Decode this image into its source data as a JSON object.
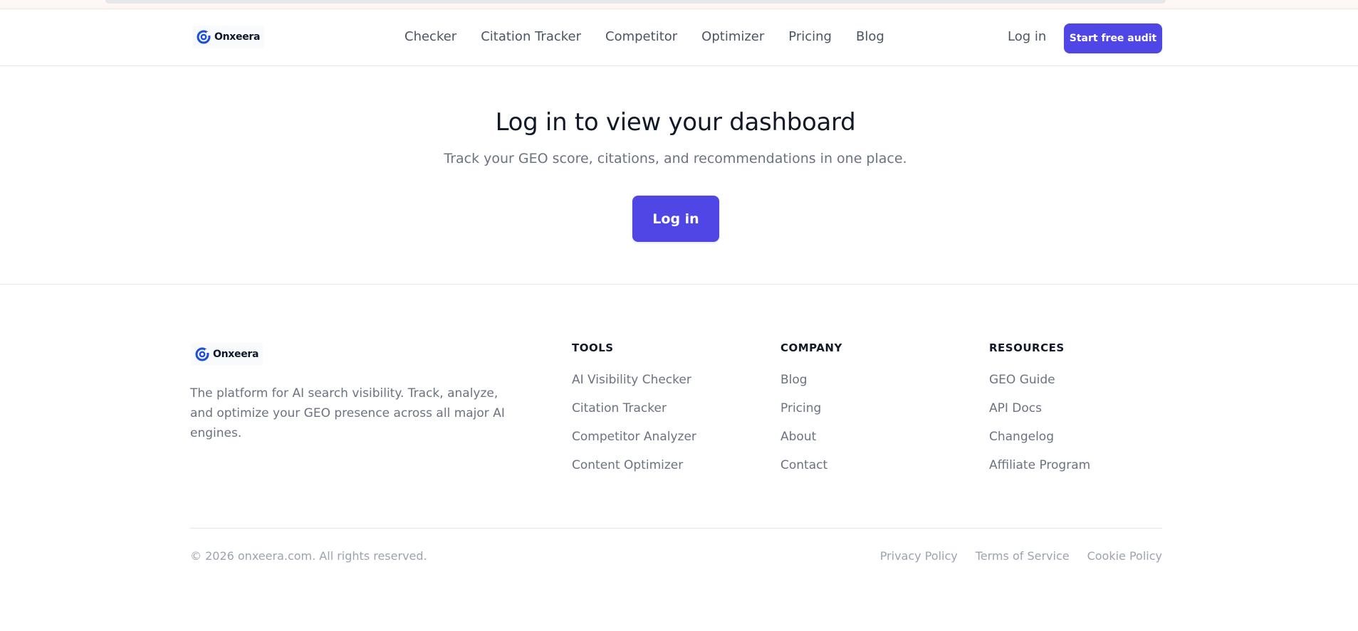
{
  "brand": {
    "name": "Onxeera",
    "accent_color": "#4f46e5",
    "logo_color": "#1d4ed8"
  },
  "header": {
    "nav": [
      "Checker",
      "Citation Tracker",
      "Competitor",
      "Optimizer",
      "Pricing",
      "Blog"
    ],
    "login_label": "Log in",
    "cta_label": "Start free audit"
  },
  "main": {
    "title": "Log in to view your dashboard",
    "subtitle": "Track your GEO score, citations, and recommendations in one place.",
    "login_button": "Log in"
  },
  "footer": {
    "description": "The platform for AI search visibility. Track, analyze, and optimize your GEO presence across all major AI engines.",
    "columns": [
      {
        "heading": "TOOLS",
        "links": [
          "AI Visibility Checker",
          "Citation Tracker",
          "Competitor Analyzer",
          "Content Optimizer"
        ]
      },
      {
        "heading": "COMPANY",
        "links": [
          "Blog",
          "Pricing",
          "About",
          "Contact"
        ]
      },
      {
        "heading": "RESOURCES",
        "links": [
          "GEO Guide",
          "API Docs",
          "Changelog",
          "Affiliate Program"
        ]
      }
    ],
    "copyright": "© 2026 onxeera.com. All rights reserved.",
    "legal_links": [
      "Privacy Policy",
      "Terms of Service",
      "Cookie Policy"
    ]
  }
}
